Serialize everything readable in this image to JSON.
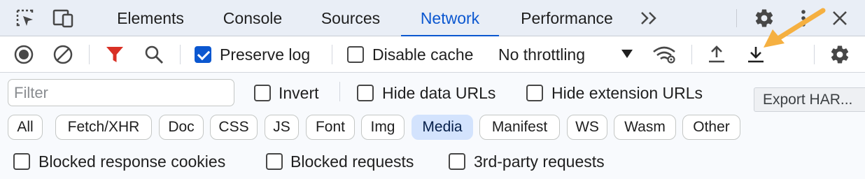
{
  "tabs": [
    {
      "label": "Elements"
    },
    {
      "label": "Console"
    },
    {
      "label": "Sources"
    },
    {
      "label": "Network"
    },
    {
      "label": "Performance"
    }
  ],
  "active_tab": "Network",
  "toolbar": {
    "preserve_log_label": "Preserve log",
    "preserve_log_checked": true,
    "disable_cache_label": "Disable cache",
    "disable_cache_checked": false,
    "throttling_value": "No throttling"
  },
  "filter": {
    "placeholder": "Filter",
    "value": "",
    "invert_label": "Invert",
    "hide_data_urls_label": "Hide data URLs",
    "hide_extension_urls_label": "Hide extension URLs"
  },
  "type_filters": [
    "All",
    "Fetch/XHR",
    "Doc",
    "CSS",
    "JS",
    "Font",
    "Img",
    "Media",
    "Manifest",
    "WS",
    "Wasm",
    "Other"
  ],
  "active_type_filter": "Media",
  "bottom_options": {
    "blocked_response_cookies_label": "Blocked response cookies",
    "blocked_requests_label": "Blocked requests",
    "third_party_requests_label": "3rd-party requests"
  },
  "tooltip": "Export HAR...",
  "icons": {
    "inspect": "inspect-element-icon",
    "device": "device-toolbar-icon",
    "more_tabs": "chevron-double-right-icon",
    "settings": "gear-icon",
    "kebab": "vertical-dots-icon",
    "close": "close-icon",
    "record": "record-icon",
    "clear": "clear-icon",
    "filter": "funnel-icon",
    "search": "search-icon",
    "network_conditions": "wifi-settings-icon",
    "import": "upload-icon",
    "export": "download-icon"
  },
  "colors": {
    "accent": "#0b57d0",
    "filter_icon": "#d93025",
    "annotation_arrow": "#f5b041",
    "active_chip": "#d3e3fd"
  }
}
